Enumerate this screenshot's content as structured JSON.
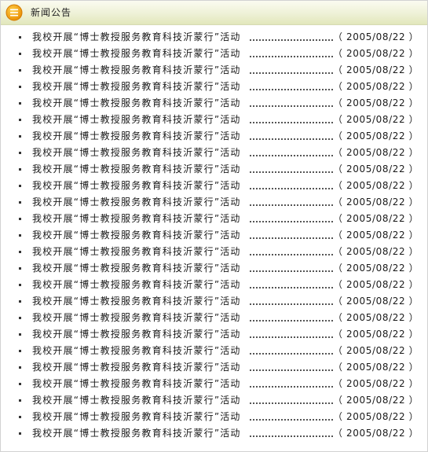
{
  "header": {
    "title": "新闻公告",
    "icon": "list-icon",
    "accent": "#f3a10c"
  },
  "news": {
    "items": [
      {
        "title": "我校开展“博士教授服务教育科技沂蒙行”活动",
        "date": "（ 2005/08/22 ）"
      },
      {
        "title": "我校开展“博士教授服务教育科技沂蒙行”活动",
        "date": "（ 2005/08/22 ）"
      },
      {
        "title": "我校开展“博士教授服务教育科技沂蒙行”活动",
        "date": "（ 2005/08/22 ）"
      },
      {
        "title": "我校开展“博士教授服务教育科技沂蒙行”活动",
        "date": "（ 2005/08/22 ）"
      },
      {
        "title": "我校开展“博士教授服务教育科技沂蒙行”活动",
        "date": "（ 2005/08/22 ）"
      },
      {
        "title": "我校开展“博士教授服务教育科技沂蒙行”活动",
        "date": "（ 2005/08/22 ）"
      },
      {
        "title": "我校开展“博士教授服务教育科技沂蒙行”活动",
        "date": "（ 2005/08/22 ）"
      },
      {
        "title": "我校开展“博士教授服务教育科技沂蒙行”活动",
        "date": "（ 2005/08/22 ）"
      },
      {
        "title": "我校开展“博士教授服务教育科技沂蒙行”活动",
        "date": "（ 2005/08/22 ）"
      },
      {
        "title": "我校开展“博士教授服务教育科技沂蒙行”活动",
        "date": "（ 2005/08/22 ）"
      },
      {
        "title": "我校开展“博士教授服务教育科技沂蒙行”活动",
        "date": "（ 2005/08/22 ）"
      },
      {
        "title": "我校开展“博士教授服务教育科技沂蒙行”活动",
        "date": "（ 2005/08/22 ）"
      },
      {
        "title": "我校开展“博士教授服务教育科技沂蒙行”活动",
        "date": "（ 2005/08/22 ）"
      },
      {
        "title": "我校开展“博士教授服务教育科技沂蒙行”活动",
        "date": "（ 2005/08/22 ）"
      },
      {
        "title": "我校开展“博士教授服务教育科技沂蒙行”活动",
        "date": "（ 2005/08/22 ）"
      },
      {
        "title": "我校开展“博士教授服务教育科技沂蒙行”活动",
        "date": "（ 2005/08/22 ）"
      },
      {
        "title": "我校开展“博士教授服务教育科技沂蒙行”活动",
        "date": "（ 2005/08/22 ）"
      },
      {
        "title": "我校开展“博士教授服务教育科技沂蒙行”活动",
        "date": "（ 2005/08/22 ）"
      },
      {
        "title": "我校开展“博士教授服务教育科技沂蒙行”活动",
        "date": "（ 2005/08/22 ）"
      },
      {
        "title": "我校开展“博士教授服务教育科技沂蒙行”活动",
        "date": "（ 2005/08/22 ）"
      },
      {
        "title": "我校开展“博士教授服务教育科技沂蒙行”活动",
        "date": "（ 2005/08/22 ）"
      },
      {
        "title": "我校开展“博士教授服务教育科技沂蒙行”活动",
        "date": "（ 2005/08/22 ）"
      },
      {
        "title": "我校开展“博士教授服务教育科技沂蒙行”活动",
        "date": "（ 2005/08/22 ）"
      },
      {
        "title": "我校开展“博士教授服务教育科技沂蒙行”活动",
        "date": "（ 2005/08/22 ）"
      },
      {
        "title": "我校开展“博士教授服务教育科技沂蒙行”活动",
        "date": "（ 2005/08/22 ）"
      }
    ]
  }
}
